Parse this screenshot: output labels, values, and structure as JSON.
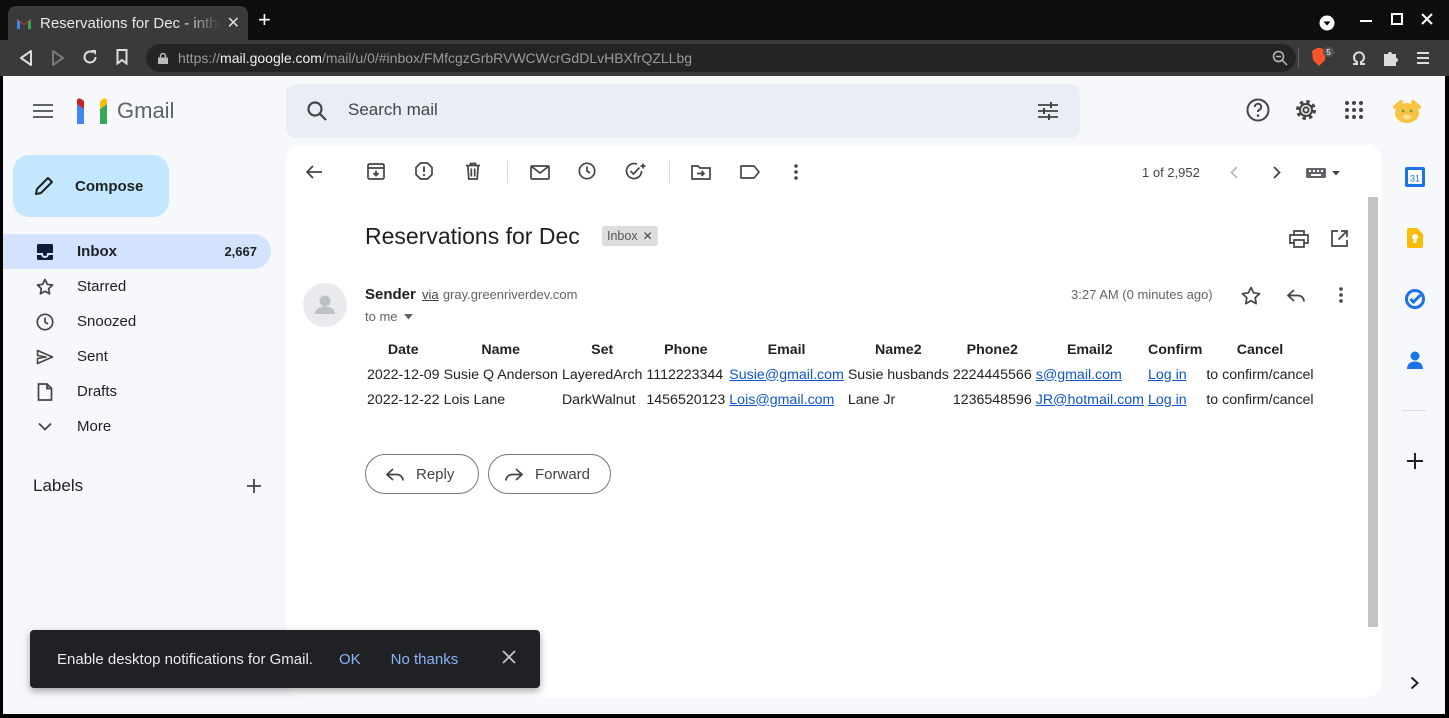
{
  "browser": {
    "tab_title": "Reservations for Dec - inthe",
    "url_scheme": "https://",
    "url_host": "mail.google.com",
    "url_path": "/mail/u/0/#inbox/FMfcgzGrbRVWCWcrGdDLvHBXfrQZLLbg",
    "ext_badge": "5"
  },
  "app": {
    "name": "Gmail",
    "search_placeholder": "Search mail",
    "compose_label": "Compose"
  },
  "nav": [
    {
      "label": "Inbox",
      "count": "2,667",
      "icon": "inbox-icon"
    },
    {
      "label": "Starred",
      "count": "",
      "icon": "star-icon"
    },
    {
      "label": "Snoozed",
      "count": "",
      "icon": "clock-icon"
    },
    {
      "label": "Sent",
      "count": "",
      "icon": "send-icon"
    },
    {
      "label": "Drafts",
      "count": "",
      "icon": "draft-icon"
    },
    {
      "label": "More",
      "count": "",
      "icon": "chevron-down-icon"
    }
  ],
  "labels_heading": "Labels",
  "toolbar": {
    "pager": "1 of 2,952"
  },
  "email": {
    "subject": "Reservations for Dec",
    "chip": "Inbox",
    "sender_name": "Sender",
    "via": "via",
    "sender_domain": "gray.greenriverdev.com",
    "to": "to me",
    "time": "3:27 AM (0 minutes ago)",
    "table": {
      "headers": [
        "Date",
        "Name",
        "Set",
        "Phone",
        "Email",
        "Name2",
        "Phone2",
        "Email2",
        "Confirm",
        "Cancel"
      ],
      "rows": [
        [
          "2022-12-09",
          "Susie Q Anderson",
          "LayeredArch",
          "1112223344",
          "Susie@gmail.com",
          "Susie husbands",
          "2224445566",
          "s@gmail.com",
          "Log in",
          "to confirm/cancel"
        ],
        [
          "2022-12-22",
          "Lois Lane",
          "DarkWalnut",
          "1456520123",
          "Lois@gmail.com",
          "Lane Jr",
          "1236548596",
          "JR@hotmail.com",
          "Log in",
          "to confirm/cancel"
        ]
      ]
    },
    "reply_label": "Reply",
    "forward_label": "Forward"
  },
  "toast": {
    "message": "Enable desktop notifications for Gmail.",
    "ok": "OK",
    "no_thanks": "No thanks"
  },
  "colors": {
    "accent": "#0b57d0",
    "compose_bg": "#c2e7ff",
    "active_nav": "#d3e3fd",
    "toast_link": "#8ab4f8"
  }
}
